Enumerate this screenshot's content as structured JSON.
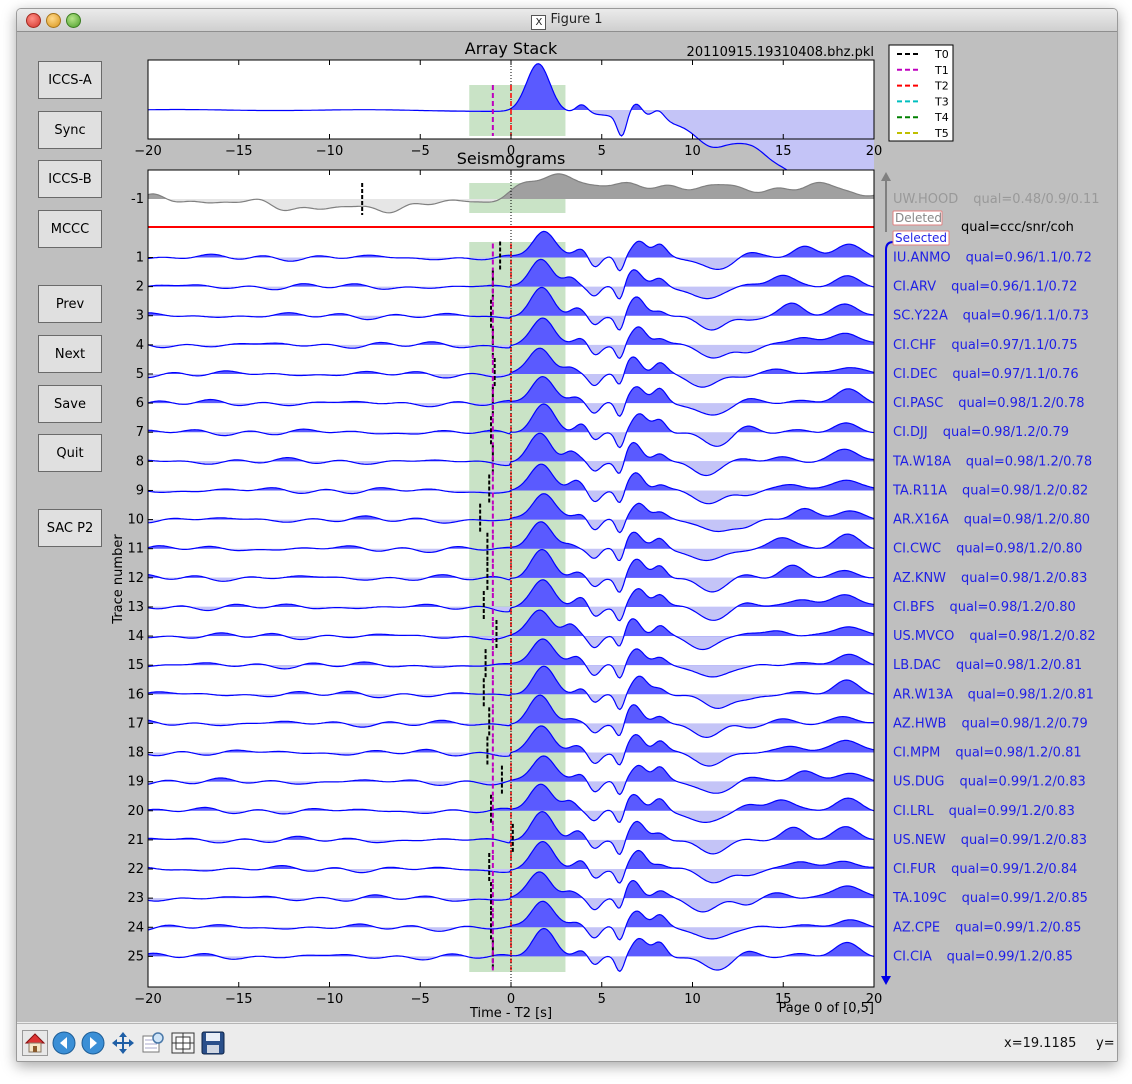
{
  "window": {
    "title": "Figure 1",
    "x_glyph": "X"
  },
  "buttons": [
    {
      "id": "iccs-a",
      "label": "ICCS-A"
    },
    {
      "id": "sync",
      "label": "Sync"
    },
    {
      "id": "iccs-b",
      "label": "ICCS-B"
    },
    {
      "id": "mccc",
      "label": "MCCC"
    },
    {
      "id": "prev",
      "label": "Prev"
    },
    {
      "id": "next",
      "label": "Next"
    },
    {
      "id": "save",
      "label": "Save"
    },
    {
      "id": "quit",
      "label": "Quit"
    },
    {
      "id": "sac-p2",
      "label": "SAC P2"
    }
  ],
  "stack": {
    "title": "Array Stack",
    "filename": "20110915.19310408.bhz.pkl",
    "xlim": [
      -20,
      20
    ],
    "xticks": [
      -20,
      -15,
      -10,
      -5,
      0,
      5,
      10,
      15,
      20
    ],
    "tick_labels": [
      "−20",
      "−15",
      "−10",
      "−5",
      "0",
      "5",
      "10",
      "15",
      "20"
    ],
    "window": [
      -2.3,
      3.0
    ],
    "markers": {
      "T1": -1.0,
      "T2": 0.0
    },
    "legend": [
      {
        "label": "T0",
        "color": "#000000"
      },
      {
        "label": "T1",
        "color": "#bf00bf"
      },
      {
        "label": "T2",
        "color": "#ff0000"
      },
      {
        "label": "T3",
        "color": "#00bfbf"
      },
      {
        "label": "T4",
        "color": "#008000"
      },
      {
        "label": "T5",
        "color": "#bfbf00"
      }
    ]
  },
  "seis": {
    "title": "Seismograms",
    "xlabel": "Time - T2 [s]",
    "ylabel": "Trace number",
    "page_text": "Page 0 of [0,5]",
    "xlim": [
      -20,
      20
    ],
    "window": [
      -2.3,
      3.0
    ],
    "deleted": {
      "number": "-1",
      "station": "UW.HOOD",
      "qual": "qual=0.48/0.9/0.11",
      "t0": -8.2
    },
    "deleted_label": "Deleted",
    "selected_label": "Selected",
    "qual_header": "qual=ccc/snr/coh",
    "traces": [
      {
        "n": "1",
        "station": "IU.ANMO",
        "qual": "qual=0.96/1.1/0.72",
        "t0": -0.6
      },
      {
        "n": "2",
        "station": "CI.ARV",
        "qual": "qual=0.96/1.1/0.72",
        "t0": -1.0
      },
      {
        "n": "3",
        "station": "SC.Y22A",
        "qual": "qual=0.96/1.1/0.73",
        "t0": -1.1
      },
      {
        "n": "4",
        "station": "CI.CHF",
        "qual": "qual=0.97/1.1/0.75",
        "t0": -1.0
      },
      {
        "n": "5",
        "station": "CI.DEC",
        "qual": "qual=0.97/1.1/0.76",
        "t0": -0.9
      },
      {
        "n": "6",
        "station": "CI.PASC",
        "qual": "qual=0.98/1.2/0.78",
        "t0": -1.0
      },
      {
        "n": "7",
        "station": "CI.DJJ",
        "qual": "qual=0.98/1.2/0.79",
        "t0": -1.1
      },
      {
        "n": "8",
        "station": "TA.W18A",
        "qual": "qual=0.98/1.2/0.78",
        "t0": -1.0
      },
      {
        "n": "9",
        "station": "TA.R11A",
        "qual": "qual=0.98/1.2/0.82",
        "t0": -1.2
      },
      {
        "n": "10",
        "station": "AR.X16A",
        "qual": "qual=0.98/1.2/0.80",
        "t0": -1.7
      },
      {
        "n": "11",
        "station": "CI.CWC",
        "qual": "qual=0.98/1.2/0.80",
        "t0": -1.3
      },
      {
        "n": "12",
        "station": "AZ.KNW",
        "qual": "qual=0.98/1.2/0.83",
        "t0": -1.3
      },
      {
        "n": "13",
        "station": "CI.BFS",
        "qual": "qual=0.98/1.2/0.80",
        "t0": -1.5
      },
      {
        "n": "14",
        "station": "US.MVCO",
        "qual": "qual=0.98/1.2/0.82",
        "t0": -0.8
      },
      {
        "n": "15",
        "station": "LB.DAC",
        "qual": "qual=0.98/1.2/0.81",
        "t0": -1.4
      },
      {
        "n": "16",
        "station": "AR.W13A",
        "qual": "qual=0.98/1.2/0.81",
        "t0": -1.5
      },
      {
        "n": "17",
        "station": "AZ.HWB",
        "qual": "qual=0.98/1.2/0.79",
        "t0": -1.2
      },
      {
        "n": "18",
        "station": "CI.MPM",
        "qual": "qual=0.98/1.2/0.81",
        "t0": -1.3
      },
      {
        "n": "19",
        "station": "US.DUG",
        "qual": "qual=0.99/1.2/0.83",
        "t0": -0.5
      },
      {
        "n": "20",
        "station": "CI.LRL",
        "qual": "qual=0.99/1.2/0.83",
        "t0": -1.1
      },
      {
        "n": "21",
        "station": "US.NEW",
        "qual": "qual=0.99/1.2/0.83",
        "t0": 0.1
      },
      {
        "n": "22",
        "station": "CI.FUR",
        "qual": "qual=0.99/1.2/0.84",
        "t0": -1.2
      },
      {
        "n": "23",
        "station": "TA.109C",
        "qual": "qual=0.99/1.2/0.85",
        "t0": -1.1
      },
      {
        "n": "24",
        "station": "AZ.CPE",
        "qual": "qual=0.99/1.2/0.85",
        "t0": -1.1
      },
      {
        "n": "25",
        "station": "CI.CIA",
        "qual": "qual=0.99/1.2/0.85",
        "t0": -1.0
      }
    ]
  },
  "colors": {
    "wave": "#0000ff",
    "fill_pos": "#5a5aff",
    "fill_neg": "#c4c4f7",
    "window": "#c9e3c6",
    "deleted_line": "#808080",
    "deleted_fill": "#a0a0a0",
    "selected_text": "#1f1fe6",
    "divider": "#ff0000",
    "t1": "#bf00bf",
    "t2": "#ff0000"
  },
  "toolbar": {
    "tools": [
      {
        "id": "home",
        "icon": "home-icon"
      },
      {
        "id": "back",
        "icon": "back-arrow-icon"
      },
      {
        "id": "forward",
        "icon": "forward-arrow-icon"
      },
      {
        "id": "pan",
        "icon": "pan-icon"
      },
      {
        "id": "zoom",
        "icon": "zoom-icon"
      },
      {
        "id": "subplots",
        "icon": "subplots-icon"
      },
      {
        "id": "save",
        "icon": "save-icon"
      }
    ],
    "x_readout": "x=19.1185",
    "y_readout": "y="
  }
}
